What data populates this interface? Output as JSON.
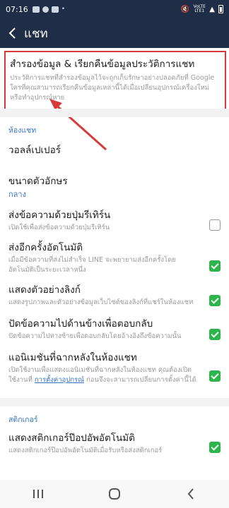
{
  "status": {
    "time": "07:16",
    "network": "VoLTE LTE1"
  },
  "appbar": {
    "title": "แชท"
  },
  "backup": {
    "title": "สำรองข้อมูล & เรียกคืนข้อมูลประวัติการแชท",
    "desc": "ประวัติการแชทที่สำรองข้อมูลไว้จะถูกเก็บรักษาอย่างปลอดภัยที่ Google ใครที่คุณสามารถเรียกคืนข้อมูลเหล่านี้ได้เมื่อเปลี่ยนอุปกรณ์เครื่องใหม่หรือทำอุปกรณ์หาย"
  },
  "section_room": "ห้องแชท",
  "wallpaper": {
    "title": "วอลล์เปเปอร์"
  },
  "fontsize": {
    "title": "ขนาดตัวอักษร",
    "value": "กลาง"
  },
  "send_enter": {
    "title": "ส่งข้อความด้วยปุ่มรีเทิร์น",
    "desc": "เปิดใช้เพื่อส่งข้อความด้วยปุ่มรีเทิร์น",
    "checked": false
  },
  "resend": {
    "title": "ส่งอีกครั้งอัตโนมัติ",
    "desc": "เมื่อมีข้อความที่ส่งไม่สำเร็จ LINE จะพยายามส่งอีกครั้งโดยอัตโนมัติเป็นระยะเวลาหนึ่ง",
    "checked": true
  },
  "link_preview": {
    "title": "แสดงตัวอย่างลิงก์",
    "desc": "แสดงรูปภาพและตัวอย่างข้อมูลเว็บไซต์ของลิงก์ที่แชร์ในห้องแชท",
    "checked": true
  },
  "swipe_reply": {
    "title": "ปัดข้อความไปด้านข้างเพื่อตอบกลับ",
    "desc": "ปัดข้อความไปทางซ้ายเพื่อตอบกลับโดยอ้างอิงถึงข้อความนั้น",
    "checked": true
  },
  "animation": {
    "title": "แอนิเมชันที่ฉากหลังในห้องแชท",
    "desc_pre": "เปิดใช้งานเพื่อแสดงแอนิเมชันที่ฉากหลังในห้องแชท คุณต้องเปิดใช้งานที่",
    "desc_link": "การตั้งค่าอุปกรณ์",
    "desc_post": "ก่อนจึงจะสามารถเปลี่ยนการตั้งค่านี้ได้",
    "checked": true
  },
  "section_sticker": "สติกเกอร์",
  "sticker_popup": {
    "title": "แสดงสติกเกอร์ป๊อปอัพอัตโนมัติ",
    "desc": "แสดงสติกเกอร์ป๊อปอัพอัตโนมัติเมื่อรับหรือส่งสติกเกอร์",
    "checked": true
  },
  "colors": {
    "header": "#1f2d47",
    "accent": "#3a73c4",
    "check": "#2bb54a",
    "highlight": "#d83a3a"
  }
}
